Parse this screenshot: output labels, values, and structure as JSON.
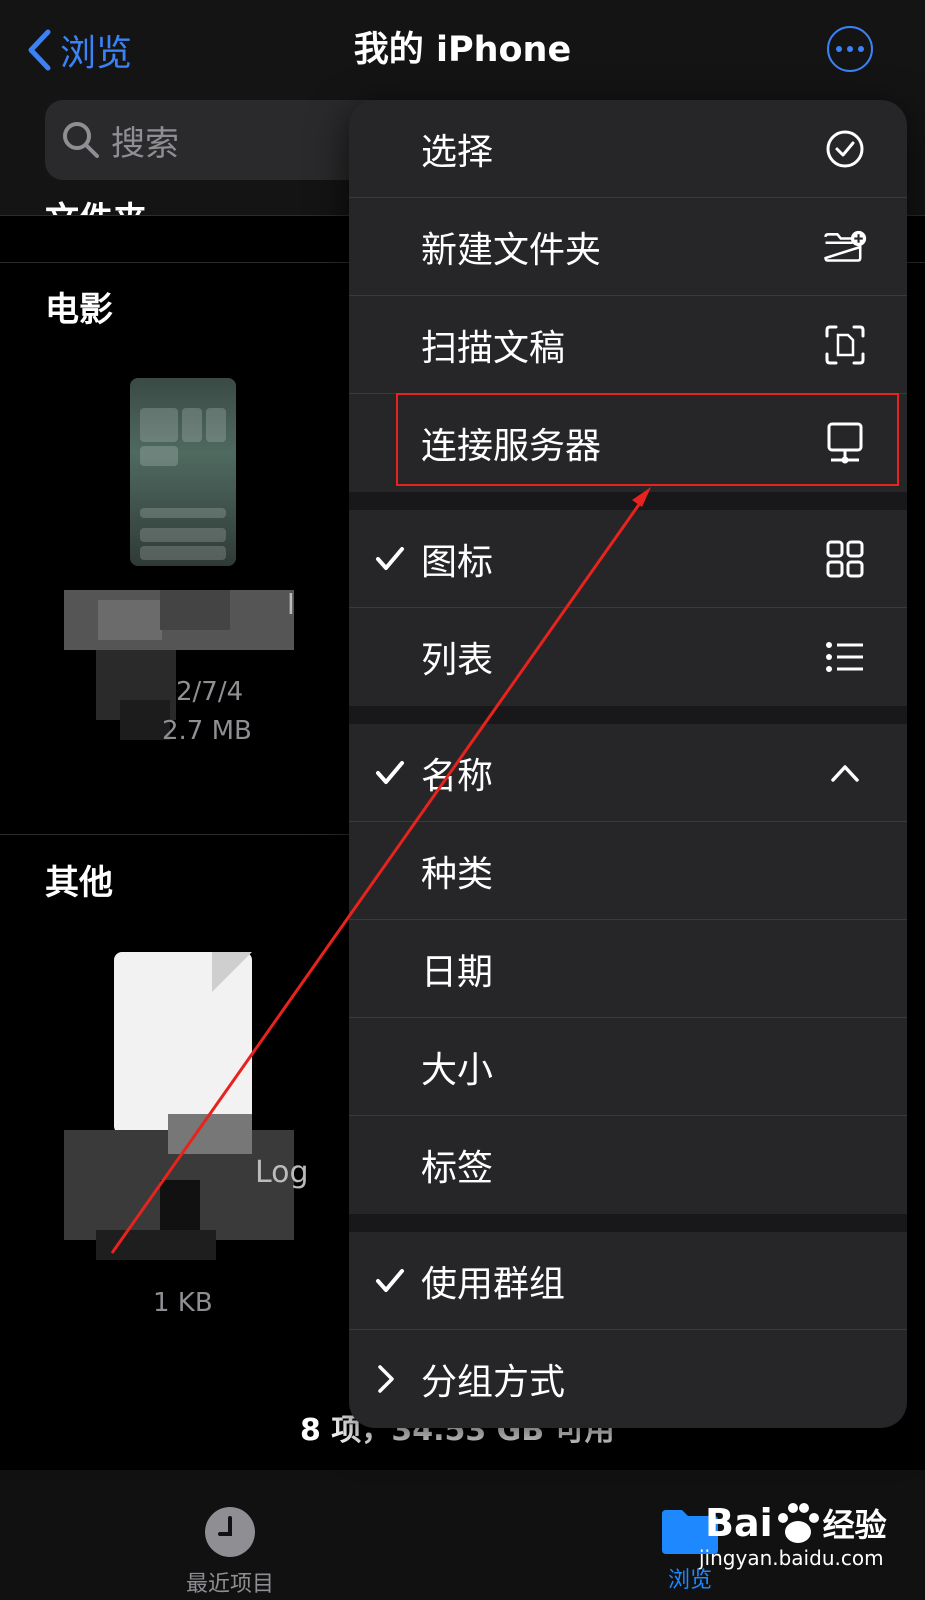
{
  "nav": {
    "back_label": "浏览",
    "title": "我的 iPhone",
    "search_placeholder": "搜索"
  },
  "sections": {
    "folders": "文件夹",
    "movies": "电影",
    "other": "其他"
  },
  "files": {
    "movie_item": {
      "name_fragment": "l",
      "date_fragment": "2/7/4",
      "size_fragment": "2.7 MB"
    },
    "other_item": {
      "name_fragment": "Log",
      "size": "1 KB"
    }
  },
  "footer": {
    "status": "8 项，34.53 GB 可用"
  },
  "menu": {
    "items": [
      {
        "label": "选择",
        "checked": false,
        "icon": "checkmark-circle-icon"
      },
      {
        "label": "新建文件夹",
        "checked": false,
        "icon": "folder-plus-icon"
      },
      {
        "label": "扫描文稿",
        "checked": false,
        "icon": "scan-document-icon"
      },
      {
        "label": "连接服务器",
        "checked": false,
        "icon": "server-icon",
        "highlighted": true
      }
    ],
    "view_items": [
      {
        "label": "图标",
        "checked": true,
        "icon": "grid-icon"
      },
      {
        "label": "列表",
        "checked": false,
        "icon": "list-icon"
      }
    ],
    "sort_items": [
      {
        "label": "名称",
        "checked": true,
        "icon": "chevron-up-icon"
      },
      {
        "label": "种类",
        "checked": false
      },
      {
        "label": "日期",
        "checked": false
      },
      {
        "label": "大小",
        "checked": false
      },
      {
        "label": "标签",
        "checked": false
      }
    ],
    "group_items": [
      {
        "label": "使用群组",
        "checked": true
      },
      {
        "label": "分组方式",
        "checked": false,
        "disclosure": true
      }
    ]
  },
  "tabbar": {
    "recents_label": "最近项目",
    "browse_label": "浏览"
  },
  "watermark": {
    "brand": "Bai",
    "brand_cn": "经验",
    "url": "jingyan.baidu.com"
  },
  "colors": {
    "accent": "#3b82f6",
    "menu_bg": "#262628",
    "highlight": "#e8231d"
  }
}
